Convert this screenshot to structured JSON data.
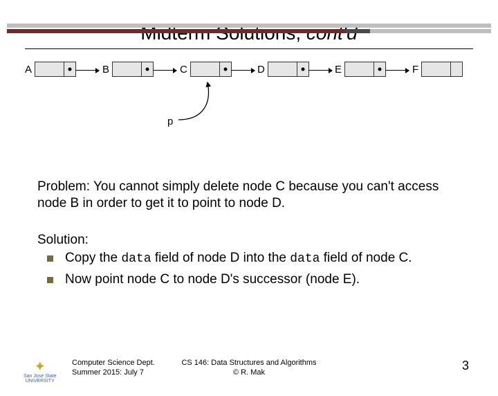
{
  "title_main": "Midterm Solutions, ",
  "title_italic": "cont'd",
  "nodes": [
    "A",
    "B",
    "C",
    "D",
    "E",
    "F"
  ],
  "pointer_label": "p",
  "problem_text": "Problem: You cannot simply delete node C because you can't access node B in order to get it to point to node D.",
  "solution_head": "Solution:",
  "solution": {
    "b1_a": "Copy the ",
    "b1_code1": "data",
    "b1_b": " field of node D into the ",
    "b1_code2": "data",
    "b1_c": " field of node C.",
    "b2": "Now point node C to node D's successor (node E)."
  },
  "footer": {
    "dept": "Computer Science Dept.",
    "term": "Summer 2015: July 7",
    "course": "CS 146: Data Structures and Algorithms",
    "copyright": "© R. Mak",
    "logo_name": "San Jose State",
    "logo_sub": "UNIVERSITY"
  },
  "page": "3"
}
